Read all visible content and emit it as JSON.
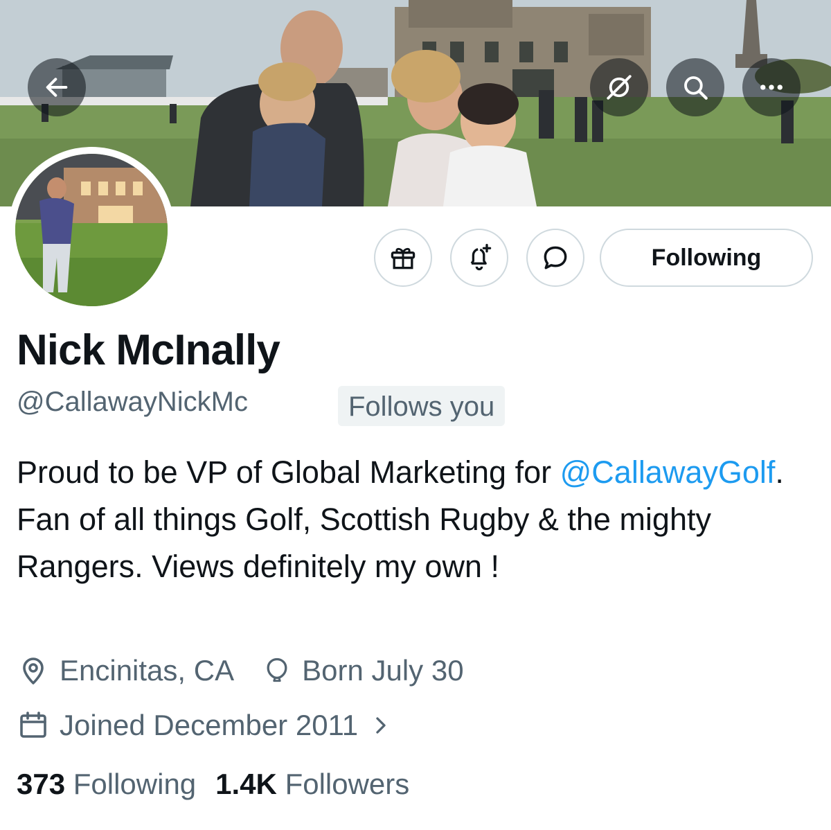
{
  "banner": {
    "back_icon": "arrow-left-icon",
    "nav_icons": [
      "link-off-icon",
      "search-icon",
      "more-icon"
    ]
  },
  "actions": {
    "icons": [
      "gift-icon",
      "bell-plus-icon",
      "message-bubble-icon"
    ],
    "following_label": "Following"
  },
  "profile": {
    "display_name": "Nick McInally",
    "handle": "@CallawayNickMc",
    "follows_you": "Follows you",
    "bio_before": "Proud to be VP of Global Marketing for ",
    "bio_mention": "@CallawayGolf",
    "bio_after": ". Fan of all things Golf, Scottish Rugby & the mighty Rangers. Views definitely my own !",
    "location": "Encinitas, CA",
    "birthday": "Born July 30",
    "joined": "Joined December 2011"
  },
  "stats": {
    "following_count": "373",
    "following_label": "Following",
    "followers_count": "1.4K",
    "followers_label": "Followers"
  },
  "colors": {
    "text": "#0f1419",
    "secondary": "#536471",
    "link": "#1d9bf0",
    "border": "#cfd9de",
    "badge_bg": "#eff3f4"
  }
}
